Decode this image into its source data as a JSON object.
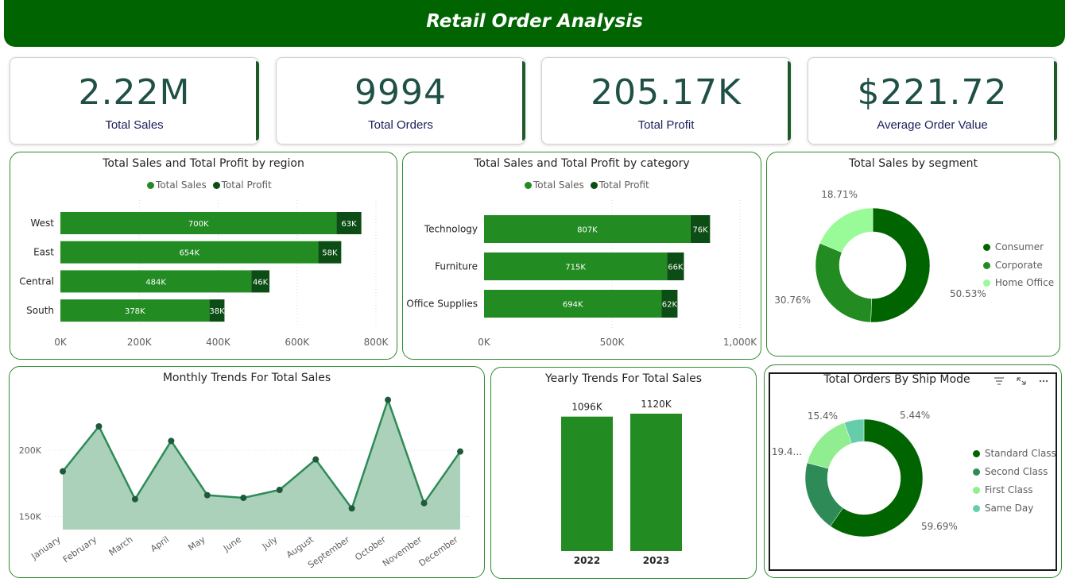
{
  "dashboard": {
    "title": "Retail Order Analysis",
    "colors": {
      "header": "#006400",
      "sales": "#228B22",
      "profit": "#0B4D14",
      "kpi_value": "#1F5046"
    }
  },
  "kpis": [
    {
      "value": "2.22M",
      "label": "Total Sales"
    },
    {
      "value": "9994",
      "label": "Total Orders"
    },
    {
      "value": "205.17K",
      "label": "Total Profit"
    },
    {
      "value": "$221.72",
      "label": "Average Order Value"
    }
  ],
  "panels": {
    "region": {
      "title": "Total Sales and Total Profit by region",
      "legend": [
        "Total Sales",
        "Total Profit"
      ]
    },
    "category": {
      "title": "Total Sales and Total Profit by category",
      "legend": [
        "Total Sales",
        "Total Profit"
      ]
    },
    "segment": {
      "title": "Total Sales by segment",
      "legend": [
        "Consumer",
        "Corporate",
        "Home Office"
      ]
    },
    "monthly": {
      "title": "Monthly Trends For Total Sales"
    },
    "yearly": {
      "title": "Yearly Trends For Total Sales"
    },
    "ship": {
      "title": "Total Orders By Ship Mode",
      "legend": [
        "Standard Class",
        "Second Class",
        "First Class",
        "Same Day"
      ],
      "icons": [
        "filter-icon",
        "focus-mode-icon",
        "more-options-icon"
      ]
    }
  },
  "chart_data": [
    {
      "id": "region",
      "type": "bar",
      "orientation": "horizontal",
      "stacked": true,
      "title": "Total Sales and Total Profit by region",
      "categories": [
        "West",
        "East",
        "Central",
        "South"
      ],
      "series": [
        {
          "name": "Total Sales",
          "values": [
            700,
            654,
            484,
            378
          ],
          "labels": [
            "700K",
            "654K",
            "484K",
            "378K"
          ],
          "color": "#228B22"
        },
        {
          "name": "Total Profit",
          "values": [
            63,
            58,
            46,
            38
          ],
          "labels": [
            "63K",
            "58K",
            "46K",
            "38K"
          ],
          "color": "#0B4D14"
        }
      ],
      "xlim": [
        0,
        800
      ],
      "xticks": [
        "0K",
        "200K",
        "400K",
        "600K",
        "800K"
      ],
      "grid": true,
      "legend_position": "top-center"
    },
    {
      "id": "category",
      "type": "bar",
      "orientation": "horizontal",
      "stacked": true,
      "title": "Total Sales and Total Profit by category",
      "categories": [
        "Technology",
        "Furniture",
        "Office Supplies"
      ],
      "series": [
        {
          "name": "Total Sales",
          "values": [
            807,
            715,
            694
          ],
          "labels": [
            "807K",
            "715K",
            "694K"
          ],
          "color": "#228B22"
        },
        {
          "name": "Total Profit",
          "values": [
            76,
            66,
            62
          ],
          "labels": [
            "76K",
            "66K",
            "62K"
          ],
          "color": "#0B4D14"
        }
      ],
      "xlim": [
        0,
        1000
      ],
      "xticks": [
        "0K",
        "500K",
        "1,000K"
      ],
      "grid": true,
      "legend_position": "top-center"
    },
    {
      "id": "segment",
      "type": "pie",
      "donut": true,
      "title": "Total Sales by segment",
      "categories": [
        "Consumer",
        "Corporate",
        "Home Office"
      ],
      "values": [
        50.53,
        30.76,
        18.71
      ],
      "labels": [
        "50.53%",
        "30.76%",
        "18.71%"
      ],
      "colors": [
        "#006400",
        "#228B22",
        "#98FB98"
      ],
      "legend_position": "right"
    },
    {
      "id": "monthly",
      "type": "area",
      "title": "Monthly Trends For Total Sales",
      "categories": [
        "January",
        "February",
        "March",
        "April",
        "May",
        "June",
        "July",
        "August",
        "September",
        "October",
        "November",
        "December"
      ],
      "values": [
        184,
        218,
        163,
        207,
        166,
        164,
        170,
        193,
        156,
        238,
        160,
        199
      ],
      "unit": "K",
      "yticks": [
        "150K",
        "200K"
      ],
      "ylim": [
        140,
        245
      ],
      "color": "#2E8B57",
      "fill": "#ABD1BB"
    },
    {
      "id": "yearly",
      "type": "bar",
      "title": "Yearly Trends For Total Sales",
      "categories": [
        "2022",
        "2023"
      ],
      "values": [
        1096,
        1120
      ],
      "labels": [
        "1096K",
        "1120K"
      ],
      "color": "#228B22"
    },
    {
      "id": "ship",
      "type": "pie",
      "donut": true,
      "title": "Total Orders By Ship Mode",
      "categories": [
        "Standard Class",
        "Second Class",
        "First Class",
        "Same Day"
      ],
      "values": [
        59.69,
        19.47,
        15.4,
        5.44
      ],
      "labels": [
        "59.69%",
        "19.4...",
        "15.4%",
        "5.44%"
      ],
      "colors": [
        "#006400",
        "#2E8B57",
        "#90EE90",
        "#66CDAA"
      ],
      "legend_position": "right"
    }
  ]
}
